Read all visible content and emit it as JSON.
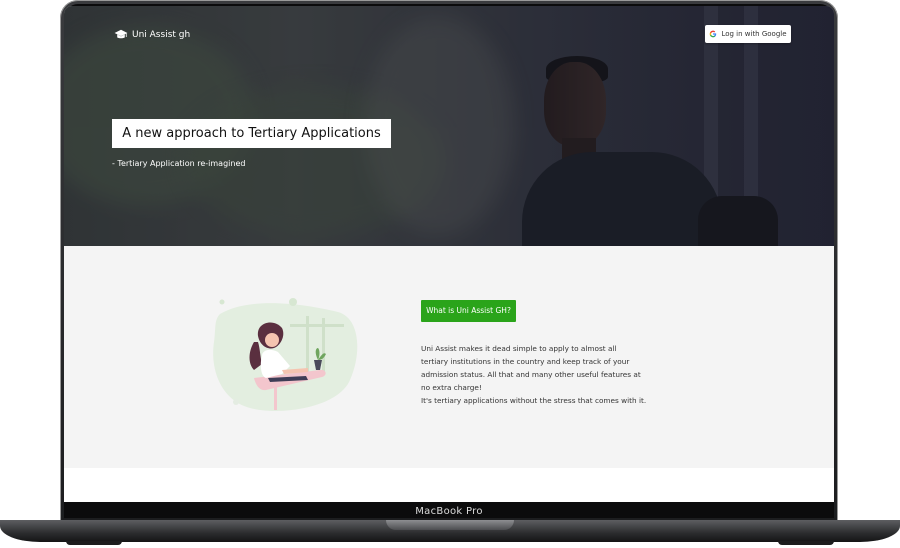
{
  "device": {
    "label": "MacBook Pro"
  },
  "header": {
    "brand_name": "Uni Assist gh",
    "brand_icon": "graduation-cap-icon",
    "login_label": "Log in with Google",
    "login_icon": "google-icon"
  },
  "hero": {
    "headline": "A new approach to Tertiary Applications",
    "tagline": "- Tertiary Application re-imagined"
  },
  "about": {
    "button_label": "What is Uni Assist GH?",
    "paragraph1": "Uni Assist makes it dead simple to apply to almost all tertiary institutions in the country and keep track of your admission status. All that and many other useful features at no extra charge!",
    "paragraph2": "It's tertiary applications without the stress that comes with it."
  },
  "colors": {
    "accent_green": "#2aa41a",
    "hero_overlay": "#2b2c3a",
    "content_bg": "#f4f4f4"
  }
}
